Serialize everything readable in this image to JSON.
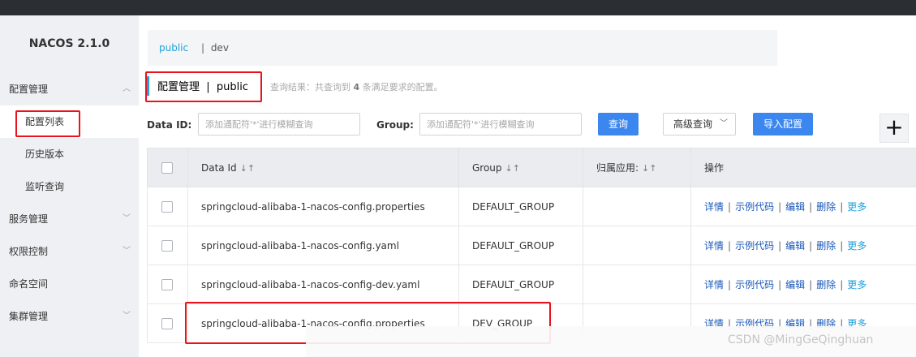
{
  "app": {
    "brand": "NACOS 2.1.0"
  },
  "sidebar": {
    "items": [
      {
        "label": "配置管理",
        "expanded": true
      },
      {
        "label": "配置列表",
        "sub": true,
        "active": true
      },
      {
        "label": "历史版本",
        "sub": true
      },
      {
        "label": "监听查询",
        "sub": true
      },
      {
        "label": "服务管理"
      },
      {
        "label": "权限控制"
      },
      {
        "label": "命名空间"
      },
      {
        "label": "集群管理"
      }
    ]
  },
  "namespace": {
    "active": "public",
    "separator": "|",
    "other": "dev"
  },
  "page": {
    "title": "配置管理  |  public",
    "result_prefix": "查询结果：共查询到",
    "result_count": "4",
    "result_suffix": "条满足要求的配置。"
  },
  "filters": {
    "data_id_label": "Data ID:",
    "data_id_placeholder": "添加通配符'*'进行模糊查询",
    "group_label": "Group:",
    "group_placeholder": "添加通配符'*'进行模糊查询",
    "search_label": "查询",
    "advanced_label": "高级查询",
    "import_label": "导入配置",
    "add_icon": "+"
  },
  "table": {
    "headers": {
      "data_id": "Data Id",
      "group": "Group",
      "app": "归属应用:",
      "ops": "操作",
      "sort_icon": "↓↑"
    },
    "rows": [
      {
        "data_id": "springcloud-alibaba-1-nacos-config.properties",
        "group": "DEFAULT_GROUP",
        "app": ""
      },
      {
        "data_id": "springcloud-alibaba-1-nacos-config.yaml",
        "group": "DEFAULT_GROUP",
        "app": ""
      },
      {
        "data_id": "springcloud-alibaba-1-nacos-config-dev.yaml",
        "group": "DEFAULT_GROUP",
        "app": ""
      },
      {
        "data_id": "springcloud-alibaba-1-nacos-config.properties",
        "group": "DEV_GROUP",
        "app": ""
      }
    ],
    "ops": {
      "detail": "详情",
      "sample": "示例代码",
      "edit": "编辑",
      "delete": "删除",
      "more": "更多",
      "sep": "|"
    }
  },
  "watermark": "CSDN @MingGeQinghuan",
  "colors": {
    "accent": "#1ea1dc",
    "primary_button": "#3b86ef",
    "highlight_box": "#e8131d",
    "sidebar_bg": "#eef0f3"
  }
}
